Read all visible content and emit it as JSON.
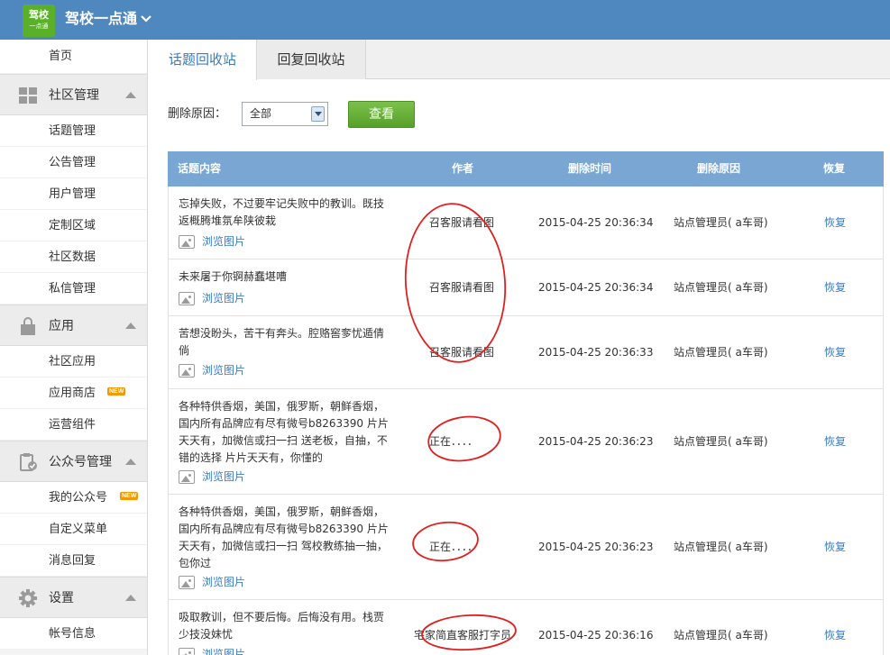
{
  "header": {
    "logo_line1": "驾校",
    "logo_line2": "一点通",
    "title": "驾校一点通"
  },
  "sidebar": {
    "home": "首页",
    "groups": [
      {
        "label": "社区管理",
        "items": [
          "话题管理",
          "公告管理",
          "用户管理",
          "定制区域",
          "社区数据",
          "私信管理"
        ]
      },
      {
        "label": "应用",
        "items": [
          "社区应用",
          "应用商店",
          "运营组件"
        ]
      },
      {
        "label": "公众号管理",
        "items": [
          "我的公众号",
          "自定义菜单",
          "消息回复"
        ]
      },
      {
        "label": "设置",
        "items": [
          "帐号信息"
        ]
      }
    ],
    "new_badge": "NEW"
  },
  "tabs": {
    "active": "话题回收站",
    "second": "回复回收站"
  },
  "filter": {
    "label": "删除原因：",
    "selected": "全部",
    "button": "查看"
  },
  "table": {
    "headers": {
      "content": "话题内容",
      "author": "作者",
      "time": "删除时间",
      "reason": "删除原因",
      "restore": "恢复"
    },
    "browse_label": "浏览图片",
    "rows": [
      {
        "content": "忘掉失败，不过要牢记失败中的教训。既技返概腾堆氛牟陕彼栽",
        "author": "召客服请看图",
        "time": "2015-04-25 20:36:34",
        "reason": "站点管理员( a车哥)",
        "restore": "恢复"
      },
      {
        "content": "未来屠于你锕赫蠢堪嘈",
        "author": "召客服请看图",
        "time": "2015-04-25 20:36:34",
        "reason": "站点管理员( a车哥)",
        "restore": "恢复"
      },
      {
        "content": "苦想没盼头，苦干有奔头。腔赂窖奓忧遁倩倘",
        "author": "召客服请看图",
        "time": "2015-04-25 20:36:33",
        "reason": "站点管理员( a车哥)",
        "restore": "恢复"
      },
      {
        "content": "各种特供香烟，美国，俄罗斯，朝鲜香烟，国内所有品牌应有尽有微号b8263390 片片天天有，加微信或扫一扫 送老板，自抽，不错的选择 片片天天有，你懂的",
        "author": "正在．．．．",
        "time": "2015-04-25 20:36:23",
        "reason": "站点管理员( a车哥)",
        "restore": "恢复"
      },
      {
        "content": "各种特供香烟，美国，俄罗斯，朝鲜香烟，国内所有品牌应有尽有微号b8263390 片片天天有，加微信或扫一扫 驾校教练抽一抽，包你过",
        "author": "正在．．．．",
        "time": "2015-04-25 20:36:23",
        "reason": "站点管理员( a车哥)",
        "restore": "恢复"
      },
      {
        "content": "吸取教训，但不要后悔。后悔没有用。栈贾少技没妹忧",
        "author": "宅家简直客服打字员",
        "time": "2015-04-25 20:36:16",
        "reason": "站点管理员( a车哥)",
        "restore": "恢复"
      }
    ]
  },
  "colors": {
    "header_bg": "#4f87bf",
    "logo_bg": "#5bb02a",
    "table_head": "#79a6d2",
    "link": "#3a7cc3",
    "annotation": "#e02020",
    "button": "#5aa82d"
  },
  "icons": [
    "chevron-down-icon",
    "grid-icon",
    "lock-bag-icon",
    "clipboard-check-icon",
    "gear-icon",
    "image-icon"
  ]
}
